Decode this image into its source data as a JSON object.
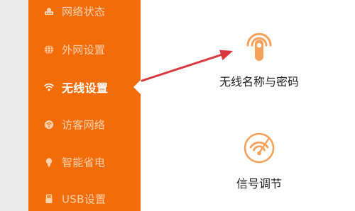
{
  "sidebar": {
    "items": [
      {
        "label": "网络状态",
        "icon": "network-status-icon"
      },
      {
        "label": "外网设置",
        "icon": "globe-icon"
      },
      {
        "label": "无线设置",
        "icon": "wifi-icon",
        "active": true
      },
      {
        "label": "访客网络",
        "icon": "guest-network-icon"
      },
      {
        "label": "智能省电",
        "icon": "bulb-icon"
      },
      {
        "label": "USB设置",
        "icon": "usb-icon"
      }
    ]
  },
  "main": {
    "features": [
      {
        "label": "无线名称与密码",
        "icon": "wifi-finger-icon"
      },
      {
        "label": "信号调节",
        "icon": "signal-adjust-icon"
      }
    ]
  },
  "colors": {
    "sidebar_bg": "#f26c0a",
    "sidebar_text": "#fbd2b0",
    "active_text": "#ffffff",
    "icon_accent": "#f5a15a",
    "annotation_arrow": "#d9363e"
  }
}
